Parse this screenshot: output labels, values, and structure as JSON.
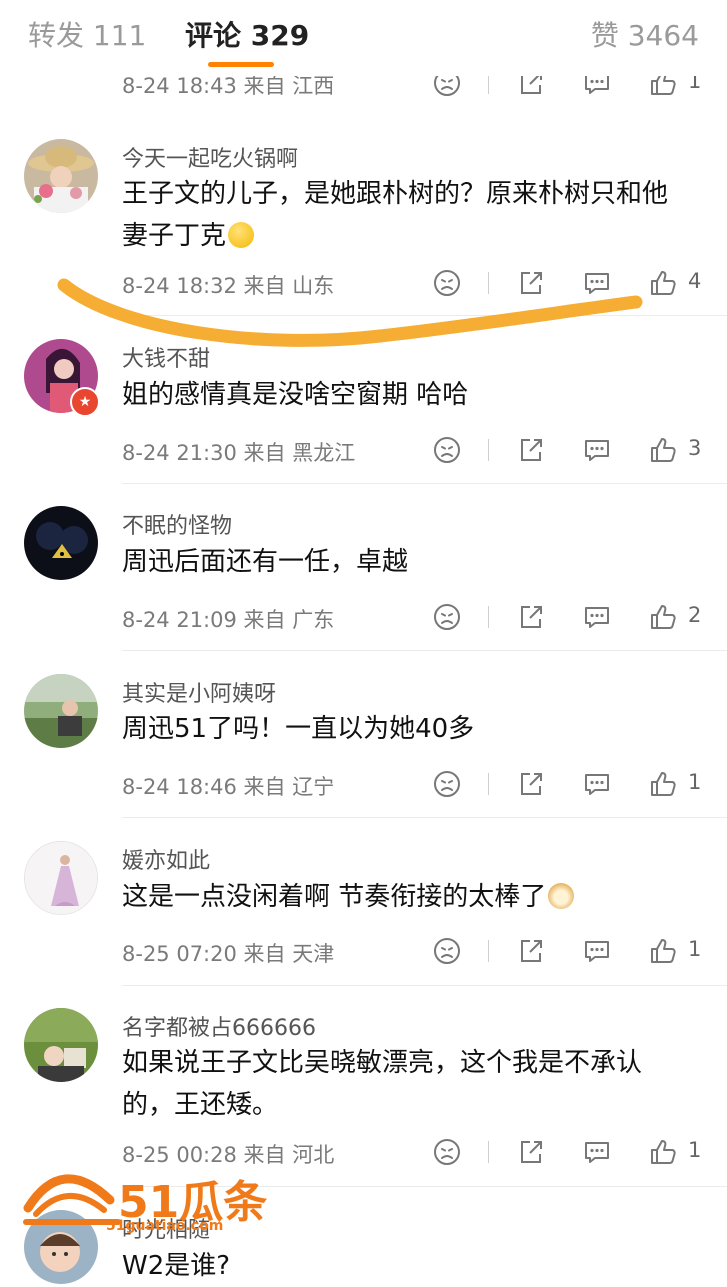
{
  "tabs": {
    "repost": "转发 111",
    "comments": "评论 329",
    "likes": "赞 3464"
  },
  "accent": "#ff8200",
  "comments": [
    {
      "author": "",
      "text": "",
      "meta": "8-24 18:43 来自 江西",
      "likes": "1"
    },
    {
      "author": "今天一起吃火锅啊",
      "text": "王子文的儿子，是她跟朴树的？原来朴树只和他妻子丁克",
      "emoji": "smile-emoji",
      "meta": "8-24 18:32 来自 山东",
      "likes": "4"
    },
    {
      "author": "大钱不甜",
      "text": "姐的感情真是没啥空窗期 哈哈",
      "meta": "8-24 21:30 来自 黑龙江",
      "likes": "3"
    },
    {
      "author": "不眠的怪物",
      "text": "周迅后面还有一任，卓越",
      "meta": "8-24 21:09 来自 广东",
      "likes": "2"
    },
    {
      "author": "其实是小阿姨呀",
      "text": "周迅51了吗！一直以为她40多",
      "meta": "8-24 18:46 来自 辽宁",
      "likes": "1"
    },
    {
      "author": "媛亦如此",
      "text": "这是一点没闲着啊 节奏衔接的太棒了",
      "emoji": "doge-emoji",
      "meta": "8-25 07:20 来自 天津",
      "likes": "1"
    },
    {
      "author": "名字都被占666666",
      "text": "如果说王子文比吴晓敏漂亮，这个我是不承认的，王还矮。",
      "meta": "8-25 00:28 来自 河北",
      "likes": "1"
    },
    {
      "author": "时光相随",
      "text": "W2是谁?",
      "meta": "",
      "likes": ""
    }
  ],
  "watermark": {
    "main": "51瓜条",
    "sub": "51guatiao.com"
  }
}
